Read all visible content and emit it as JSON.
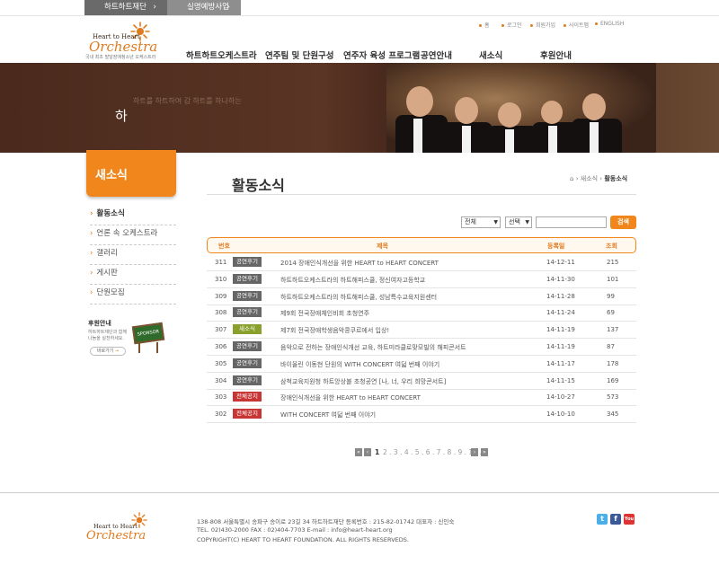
{
  "top_tabs": [
    {
      "label": "하트하트재단"
    },
    {
      "label": "실명예방사업"
    }
  ],
  "util_links": [
    "홈",
    "로그인",
    "회원가입",
    "사이트맵",
    "ENGLISH"
  ],
  "logo": {
    "small": "Heart to Heart",
    "big": "Orchestra",
    "sub": "국내 최초 발달장애청소년 오케스트라"
  },
  "gnb": [
    "하트하트오케스트라",
    "연주팀 및 단원구성",
    "연주자 육성 프로그램",
    "공연안내",
    "새소식",
    "후원안내"
  ],
  "hero": {
    "faint": "하트를 하트하여 감 하트를 하나하는",
    "char": "하"
  },
  "side": {
    "title": "새소식",
    "items": [
      "활동소식",
      "언론 속 오케스트라",
      "갤러리",
      "게시판",
      "단원모집"
    ],
    "support_title": "후원안내",
    "support_text1": "하트하트재단과 함께",
    "support_text2": "나눔을 실천하세요.",
    "support_btn": "바로가기",
    "sign": "SPONSOR"
  },
  "page_title": "활동소식",
  "breadcrumb": {
    "home": "⌂",
    "parent": "새소식",
    "current": "활동소식"
  },
  "search": {
    "filter1": "전체",
    "filter2": "선택",
    "button": "검색"
  },
  "table": {
    "headers": [
      "번호",
      "제목",
      "등록일",
      "조회"
    ],
    "rows": [
      {
        "no": "311",
        "badge": "공연후기",
        "type": "perf",
        "title": "2014 장애인식개선을 위한 HEART to HEART CONCERT",
        "date": "14-12-11",
        "views": "215"
      },
      {
        "no": "310",
        "badge": "공연후기",
        "type": "perf",
        "title": "하트하트오케스트라의 하트해피스쿨, 정신여자고등학교",
        "date": "14-11-30",
        "views": "101"
      },
      {
        "no": "309",
        "badge": "공연후기",
        "type": "perf",
        "title": "하트하트오케스트라의 하트해피스쿨, 성남특수교육지원센터",
        "date": "14-11-28",
        "views": "99"
      },
      {
        "no": "308",
        "badge": "공연후기",
        "type": "perf",
        "title": "제9회 전국장애체인비회 초청연주",
        "date": "14-11-24",
        "views": "69"
      },
      {
        "no": "307",
        "badge": "새소식",
        "type": "news",
        "title": "제7회 전국장애학생음악콩쿠르에서 입상!",
        "date": "14-11-19",
        "views": "137"
      },
      {
        "no": "306",
        "badge": "공연후기",
        "type": "perf",
        "title": "음악으로 전하는 장애인식개선 교육, 하트미라클로맞모빌의 해피콘서트",
        "date": "14-11-19",
        "views": "87"
      },
      {
        "no": "305",
        "badge": "공연후기",
        "type": "perf",
        "title": "바이올린 이동현 단원의 WITH CONCERT 여덟 번째 이야기",
        "date": "14-11-17",
        "views": "178"
      },
      {
        "no": "304",
        "badge": "공연후기",
        "type": "perf",
        "title": "삼척교육지원청 하트앙상블 초청공연 [나, 너, 우리 희망콘서트]",
        "date": "14-11-15",
        "views": "169"
      },
      {
        "no": "303",
        "badge": "전체공지",
        "type": "notice",
        "title": "장애인식개선을 위한 HEART to HEART CONCERT",
        "date": "14-10-27",
        "views": "573"
      },
      {
        "no": "302",
        "badge": "전체공지",
        "type": "notice",
        "title": "WITH CONCERT 여덟 번째 이야기",
        "date": "14-10-10",
        "views": "345"
      }
    ]
  },
  "pager": {
    "first": "«",
    "prev": "‹",
    "current": "1",
    "pages": "2 . 3 . 4 . 5 . 6 . 7 . 8 . 9 . 10 .",
    "next": "›",
    "last": "»"
  },
  "footer": {
    "logo_small": "Heart to Heart",
    "logo_big": "Orchestra",
    "line1": "138-808  서울특별시 송파구 송이로 23길 34  하트하트재단      등록번호 : 215-82-01742          대표자 : 신인숙",
    "line2": "TEL. 02)430-2000         FAX : 02)404-7703           E-mail : info@heart-heart.org",
    "line3": "COPYRIGHT(C) HEART TO HEART FOUNDATION. ALL RIGHTS RESERVEDS.",
    "sns": [
      "t",
      "f",
      "You"
    ]
  },
  "colors": {
    "accent": "#f0861c",
    "notice": "#c83535",
    "news": "#8aa02d",
    "perf": "#666666"
  }
}
